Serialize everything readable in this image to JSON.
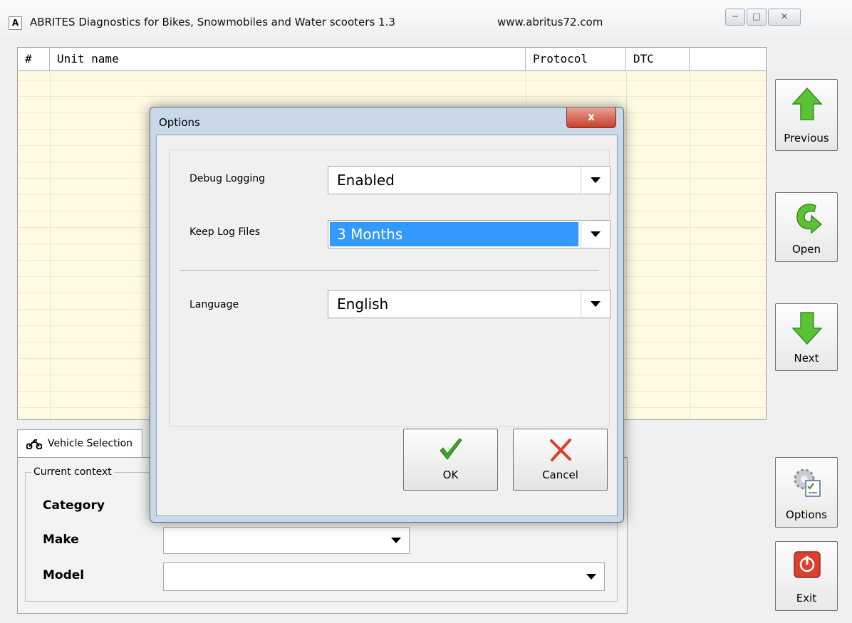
{
  "window": {
    "title": "ABRITES Diagnostics for Bikes, Snowmobiles and Water scooters 1.3",
    "url": "www.abritus72.com",
    "app_icon": "A"
  },
  "grid": {
    "columns": [
      "#",
      "Unit name",
      "Protocol",
      "DTC"
    ]
  },
  "sidebar": {
    "previous": "Previous",
    "open": "Open",
    "next": "Next",
    "options": "Options",
    "exit": "Exit"
  },
  "tab": {
    "label": "Vehicle Selection"
  },
  "context": {
    "legend": "Current context",
    "category_label": "Category",
    "make_label": "Make",
    "model_label": "Model",
    "make_value": "",
    "model_value": ""
  },
  "dialog": {
    "title": "Options",
    "close": "x",
    "debug_label": "Debug Logging",
    "debug_value": "Enabled",
    "keep_label": "Keep Log Files",
    "keep_value": "3 Months",
    "language_label": "Language",
    "language_value": "English",
    "ok": "OK",
    "cancel": "Cancel"
  },
  "colors": {
    "grid_bg": "#fffbe3",
    "selection": "#3399ff",
    "arrow_green": "#5bc236",
    "exit_red": "#d9412c"
  }
}
